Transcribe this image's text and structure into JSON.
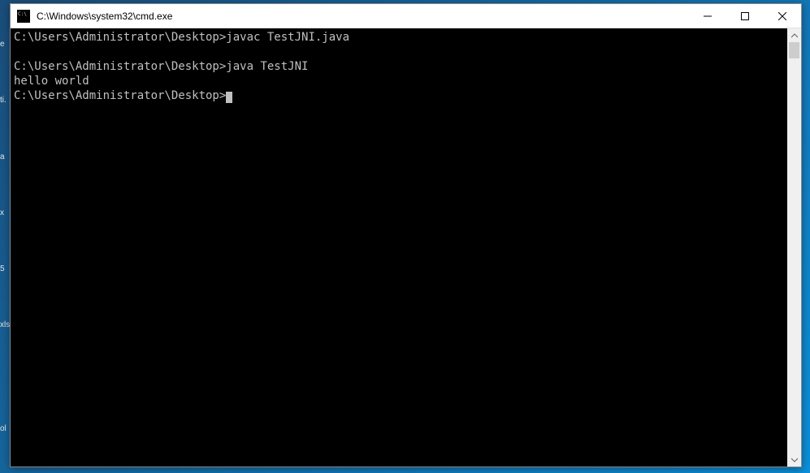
{
  "desktop_edge_hints": [
    "e",
    "ti.",
    "a",
    "x",
    "5",
    "xls",
    "",
    "ol"
  ],
  "window": {
    "title": "C:\\Windows\\system32\\cmd.exe"
  },
  "terminal": {
    "lines": [
      {
        "prompt": "C:\\Users\\Administrator\\Desktop>",
        "command": "javac TestJNI.java"
      },
      {
        "prompt": "",
        "command": ""
      },
      {
        "prompt": "C:\\Users\\Administrator\\Desktop>",
        "command": "java TestJNI"
      },
      {
        "prompt": "",
        "command": "hello world"
      },
      {
        "prompt": "C:\\Users\\Administrator\\Desktop>",
        "command": "",
        "cursor": true
      }
    ]
  }
}
